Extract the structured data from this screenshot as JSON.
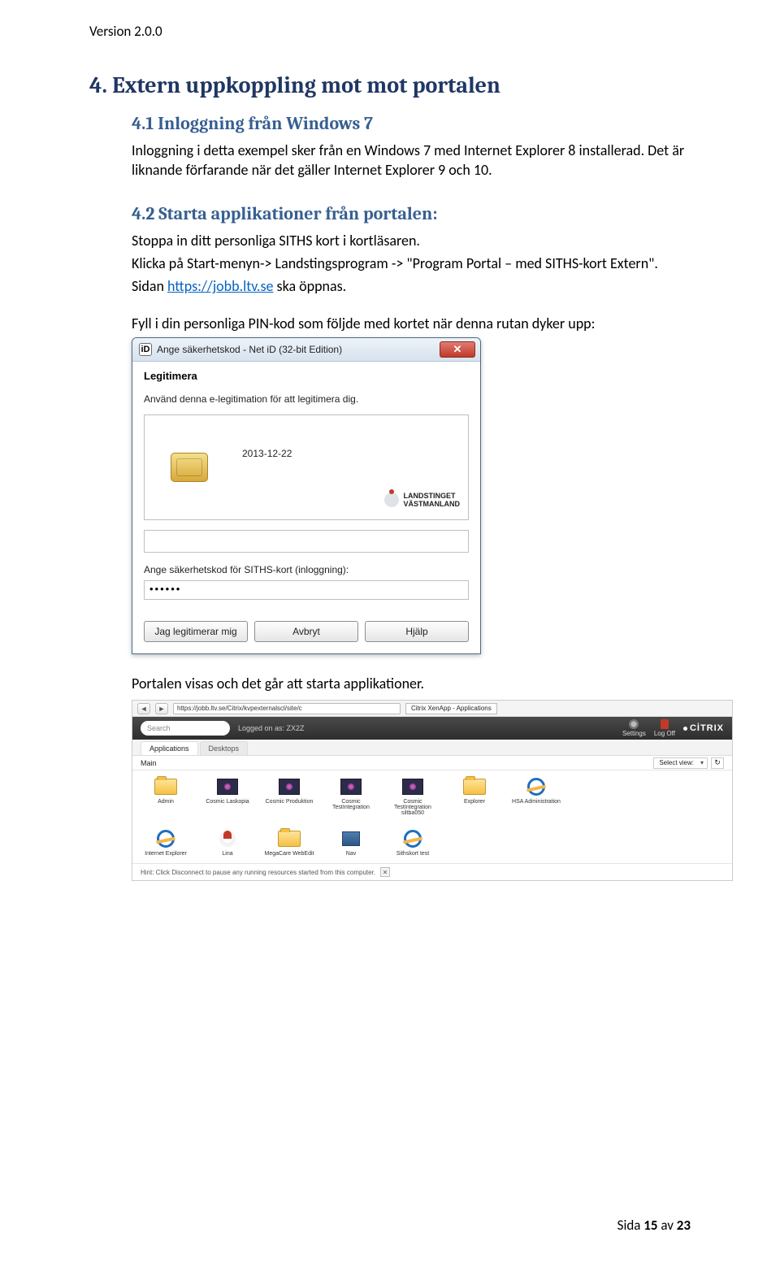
{
  "version_label": "Version 2.0.0",
  "section_title": "4. Extern uppkoppling mot mot portalen",
  "subsection_1_title": "4.1 Inloggning från Windows 7",
  "p1": "Inloggning i detta exempel sker från en Windows 7 med Internet Explorer 8 installerad. Det är liknande förfarande när det gäller Internet Explorer 9 och 10.",
  "subsection_2_title": "4.2 Starta applikationer från portalen:",
  "p2": "Stoppa in ditt personliga SITHS kort i kortläsaren.",
  "p3": "Klicka på Start-menyn-> Landstingsprogram -> \"Program Portal – med SITHS-kort Extern\".",
  "p4_prefix": "Sidan ",
  "p4_link": "https://jobb.ltv.se",
  "p4_suffix": " ska öppnas.",
  "p5": "Fyll i din personliga PIN-kod som följde med kortet när denna rutan dyker upp:",
  "dialog": {
    "title": "Ange säkerhetskod - Net iD (32-bit Edition)",
    "icon_text": "iD",
    "close_x": "✕",
    "heading": "Legitimera",
    "helptext": "Använd denna e-legitimation för att legitimera dig.",
    "card_date": "2013-12-22",
    "brand_line1": "LANDSTINGET",
    "brand_line2": "VÄSTMANLAND",
    "prompt": "Ange säkerhetskod för SITHS-kort (inloggning):",
    "pin_mask": "••••••",
    "btn_ok": "Jag legitimerar mig",
    "btn_cancel": "Avbryt",
    "btn_help": "Hjälp"
  },
  "portal_caption": "Portalen visas och det går att starta applikationer.",
  "portal": {
    "url": "https://jobb.ltv.se/Citrix/kvpexternalscl/site/c",
    "tab_title": "Citrix XenApp - Applications",
    "search_placeholder": "Search",
    "logged_on": "Logged on as: ZX2Z",
    "hdr_settings": "Settings",
    "hdr_logoff": "Log Off",
    "brand": "CİTRIX",
    "tab_apps": "Applications",
    "tab_desktops": "Desktops",
    "main_label": "Main",
    "select_view": "Select view:",
    "refresh_glyph": "↻",
    "apps_row1": [
      {
        "label": "Admin",
        "icon": "folder"
      },
      {
        "label": "Cosmic Laskopia",
        "icon": "cosmic"
      },
      {
        "label": "Cosmic Produktion",
        "icon": "cosmic"
      },
      {
        "label": "Cosmic TestIntegration",
        "icon": "cosmic"
      },
      {
        "label": "Cosmic TestIntegration siltba050",
        "icon": "cosmic"
      },
      {
        "label": "Explorer",
        "icon": "folder"
      },
      {
        "label": "HSA Administration",
        "icon": "ie"
      }
    ],
    "apps_row2": [
      {
        "label": "Internet Explorer",
        "icon": "ie"
      },
      {
        "label": "Lina",
        "icon": "lina"
      },
      {
        "label": "MegaCare WebEdit",
        "icon": "folder"
      },
      {
        "label": "Nav",
        "icon": "nav"
      },
      {
        "label": "Sithskort test",
        "icon": "ie"
      }
    ],
    "hint": "Hint: Click Disconnect to pause any running resources started from this computer.",
    "hint_x": "✕"
  },
  "footer": {
    "prefix": "Sida ",
    "page": "15",
    "mid": " av ",
    "total": "23"
  }
}
